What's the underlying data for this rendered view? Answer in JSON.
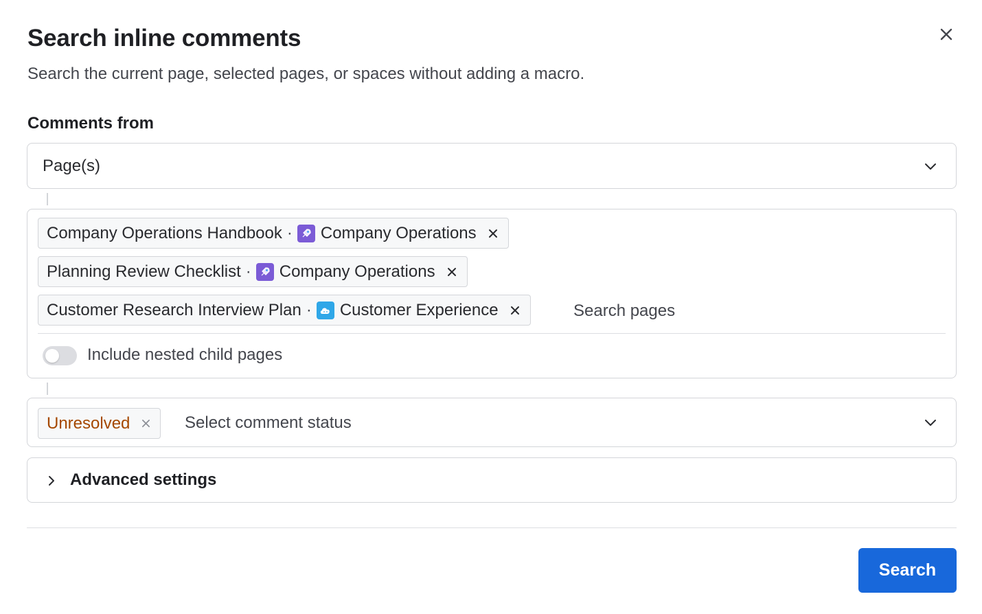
{
  "dialog": {
    "title": "Search inline comments",
    "subtitle": "Search the current page, selected pages, or spaces without adding a macro.",
    "close_icon": "close-icon"
  },
  "comments_from": {
    "label": "Comments from",
    "selected": "Page(s)"
  },
  "pages": {
    "chips": [
      {
        "page": "Company Operations Handbook",
        "separator": "·",
        "space": "Company Operations",
        "space_icon": "rocket-icon",
        "space_color": "#7b5bd6"
      },
      {
        "page": "Planning Review Checklist",
        "separator": "·",
        "space": "Company Operations",
        "space_icon": "rocket-icon",
        "space_color": "#7b5bd6"
      },
      {
        "page": "Customer Research Interview Plan",
        "separator": "·",
        "space": "Customer Experience",
        "space_icon": "cloud-icon",
        "space_color": "#2fa7e8"
      }
    ],
    "search_placeholder": "Search pages",
    "include_nested_label": "Include nested child pages",
    "include_nested": false
  },
  "status": {
    "chip": "Unresolved",
    "chip_color": "#a54800",
    "placeholder": "Select comment status"
  },
  "advanced": {
    "label": "Advanced settings"
  },
  "footer": {
    "search_label": "Search",
    "accent": "#1868db"
  }
}
